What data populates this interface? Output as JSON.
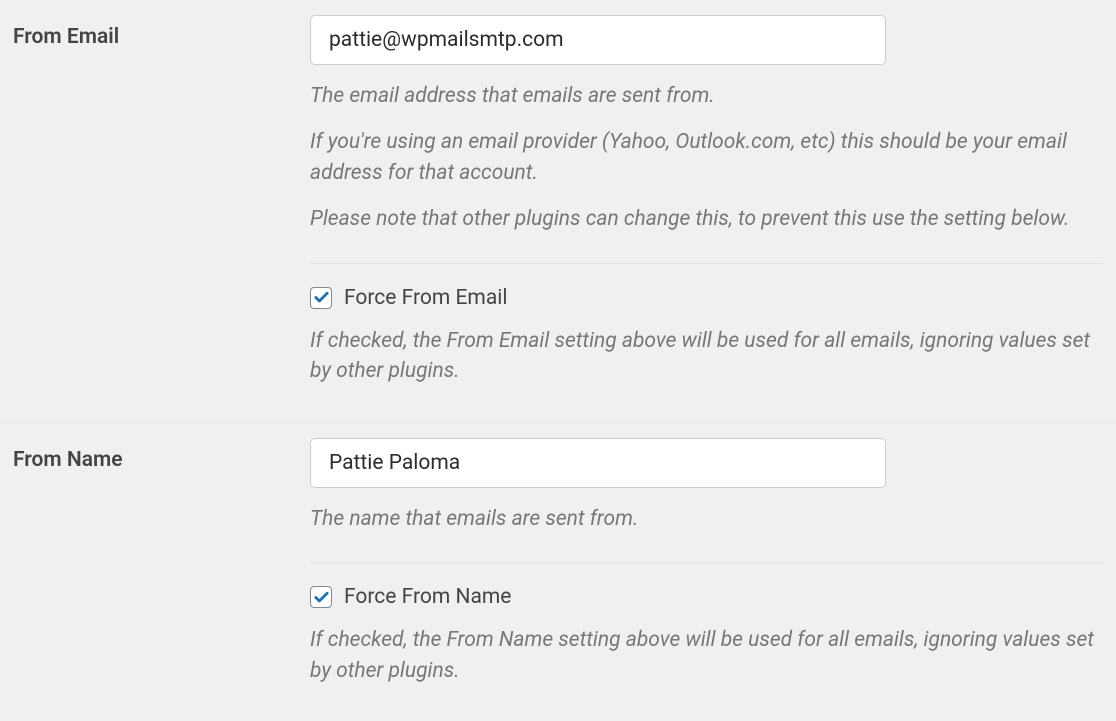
{
  "from_email": {
    "label": "From Email",
    "value": "pattie@wpmailsmtp.com",
    "desc_line1": "The email address that emails are sent from.",
    "desc_line2": "If you're using an email provider (Yahoo, Outlook.com, etc) this should be your email address for that account.",
    "desc_line3": "Please note that other plugins can change this, to prevent this use the setting below.",
    "force": {
      "checked": true,
      "label": "Force From Email",
      "desc": "If checked, the From Email setting above will be used for all emails, ignoring values set by other plugins."
    }
  },
  "from_name": {
    "label": "From Name",
    "value": "Pattie Paloma",
    "desc": "The name that emails are sent from.",
    "force": {
      "checked": true,
      "label": "Force From Name",
      "desc": "If checked, the From Name setting above will be used for all emails, ignoring values set by other plugins."
    }
  },
  "colors": {
    "accent": "#2271b1"
  }
}
